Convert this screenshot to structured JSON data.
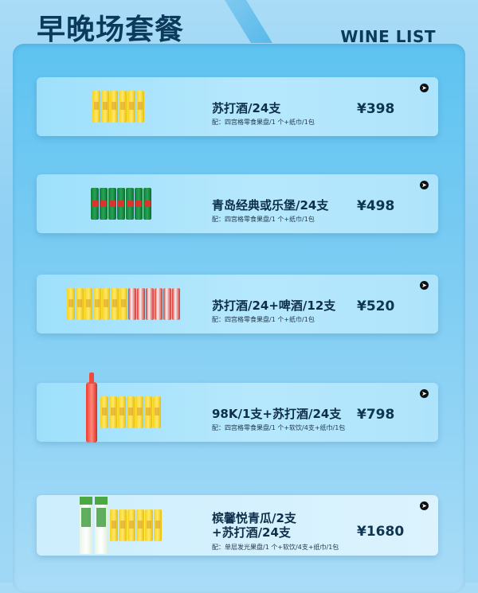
{
  "header": {
    "title": "早晚场套餐",
    "subtitle": "WINE LIST"
  },
  "packages": [
    {
      "name_lines": [
        "苏打酒/24支"
      ],
      "note": "配：四宫格零食果盘/1 个+纸巾/1包",
      "price": "¥398"
    },
    {
      "name_lines": [
        "青岛经典或乐堡/24支"
      ],
      "note": "配：四宫格零食果盘/1 个+纸巾/1包",
      "price": "¥498"
    },
    {
      "name_lines": [
        "苏打酒/24+啤酒/12支"
      ],
      "note": "配：四宫格零食果盘/1 个+纸巾/1包",
      "price": "¥520"
    },
    {
      "name_lines": [
        "98K/1支+苏打酒/24支"
      ],
      "note": "配：四宫格零食果盘/1 个+软饮/4支+纸巾/1包",
      "price": "¥798"
    },
    {
      "name_lines": [
        "槟馨悦青瓜/2支",
        "+苏打酒/24支"
      ],
      "note": "配：单层发光果盘/1 个+软饮/4支+纸巾/1包",
      "price": "¥1680"
    }
  ],
  "icons": {
    "arrow": "arrow-right-circle-icon"
  }
}
